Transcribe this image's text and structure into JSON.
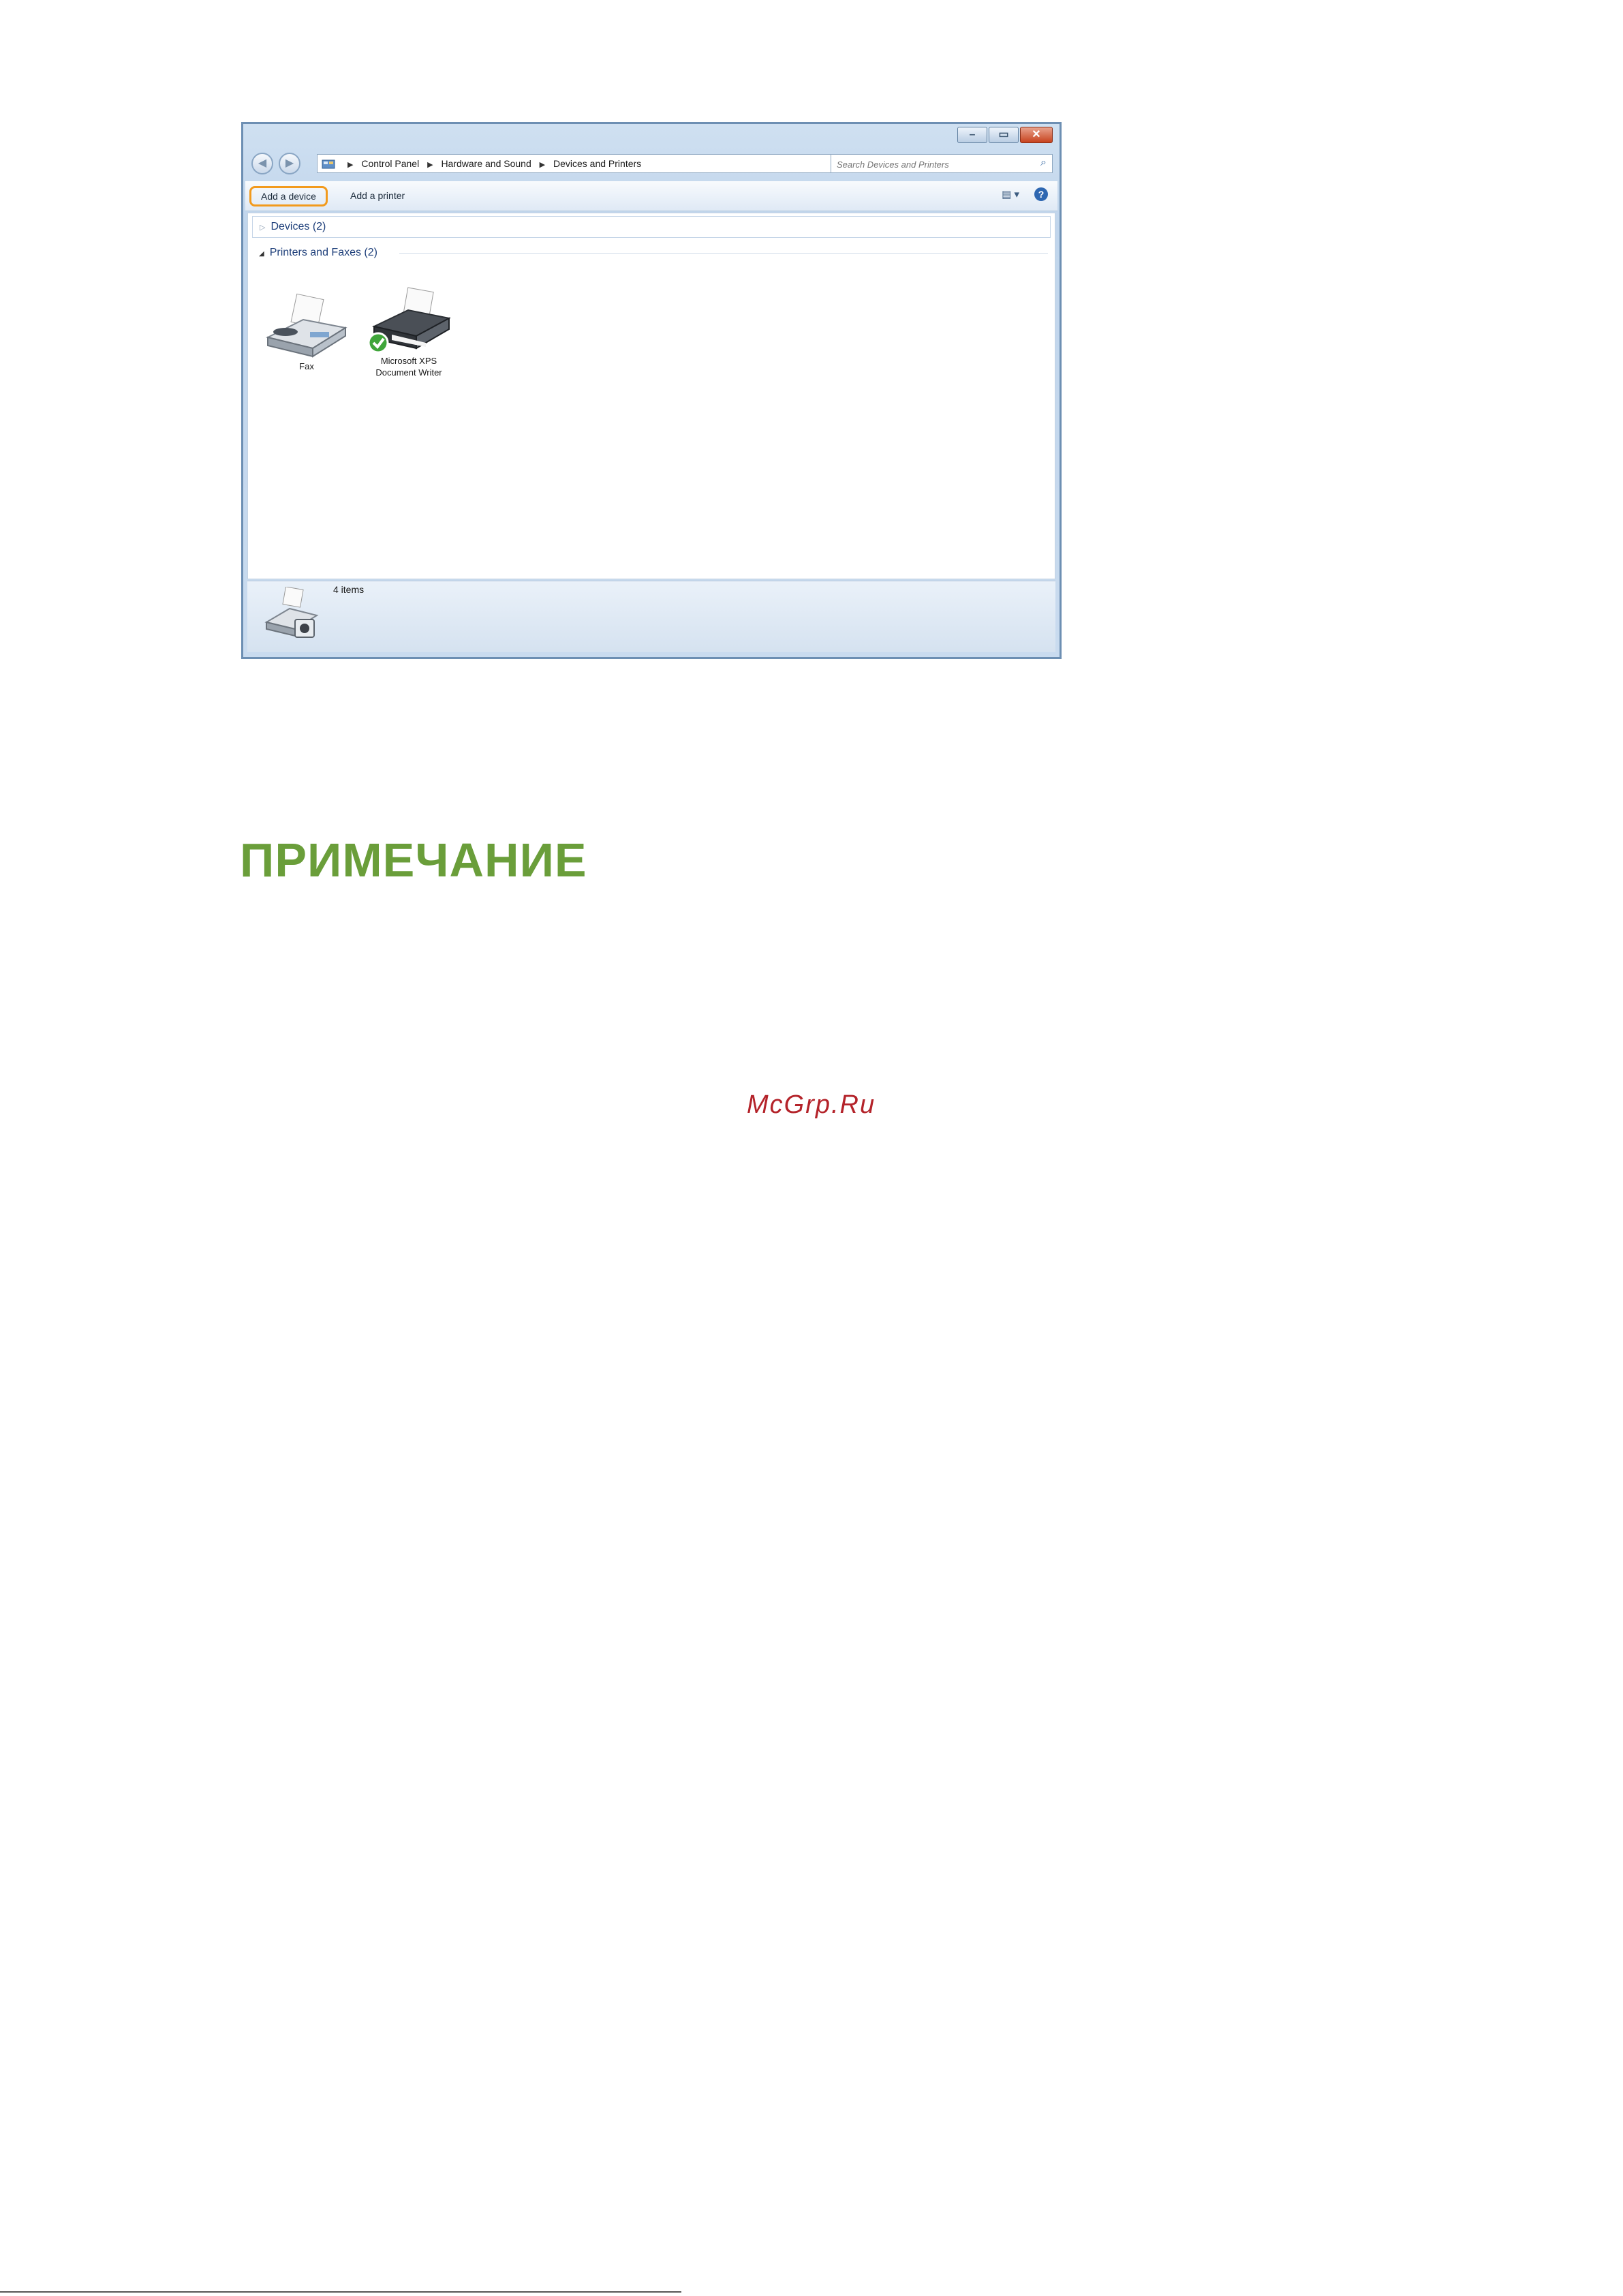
{
  "window": {
    "breadcrumb": [
      "Control Panel",
      "Hardware and Sound",
      "Devices and Printers"
    ],
    "search": {
      "placeholder": "Search Devices and Printers"
    },
    "toolbar": {
      "add_device_label": "Add a device",
      "add_printer_label": "Add a printer"
    },
    "groups": {
      "devices_label": "Devices (2)",
      "printers_label": "Printers and Faxes (2)"
    },
    "devices": [
      {
        "label": "Fax",
        "icon": "fax-icon"
      },
      {
        "label": "Microsoft XPS Document Writer",
        "line1": "Microsoft XPS",
        "line2": "Document Writer",
        "icon": "printer-icon",
        "default": true
      }
    ],
    "details": {
      "count_text": "4 items"
    }
  },
  "document": {
    "heading": "ПРИМЕЧАНИЕ",
    "watermark": "McGrp.Ru"
  },
  "colors": {
    "highlight": "#f29a1d",
    "heading": "#6a9e3a",
    "watermark": "#b4232a"
  }
}
